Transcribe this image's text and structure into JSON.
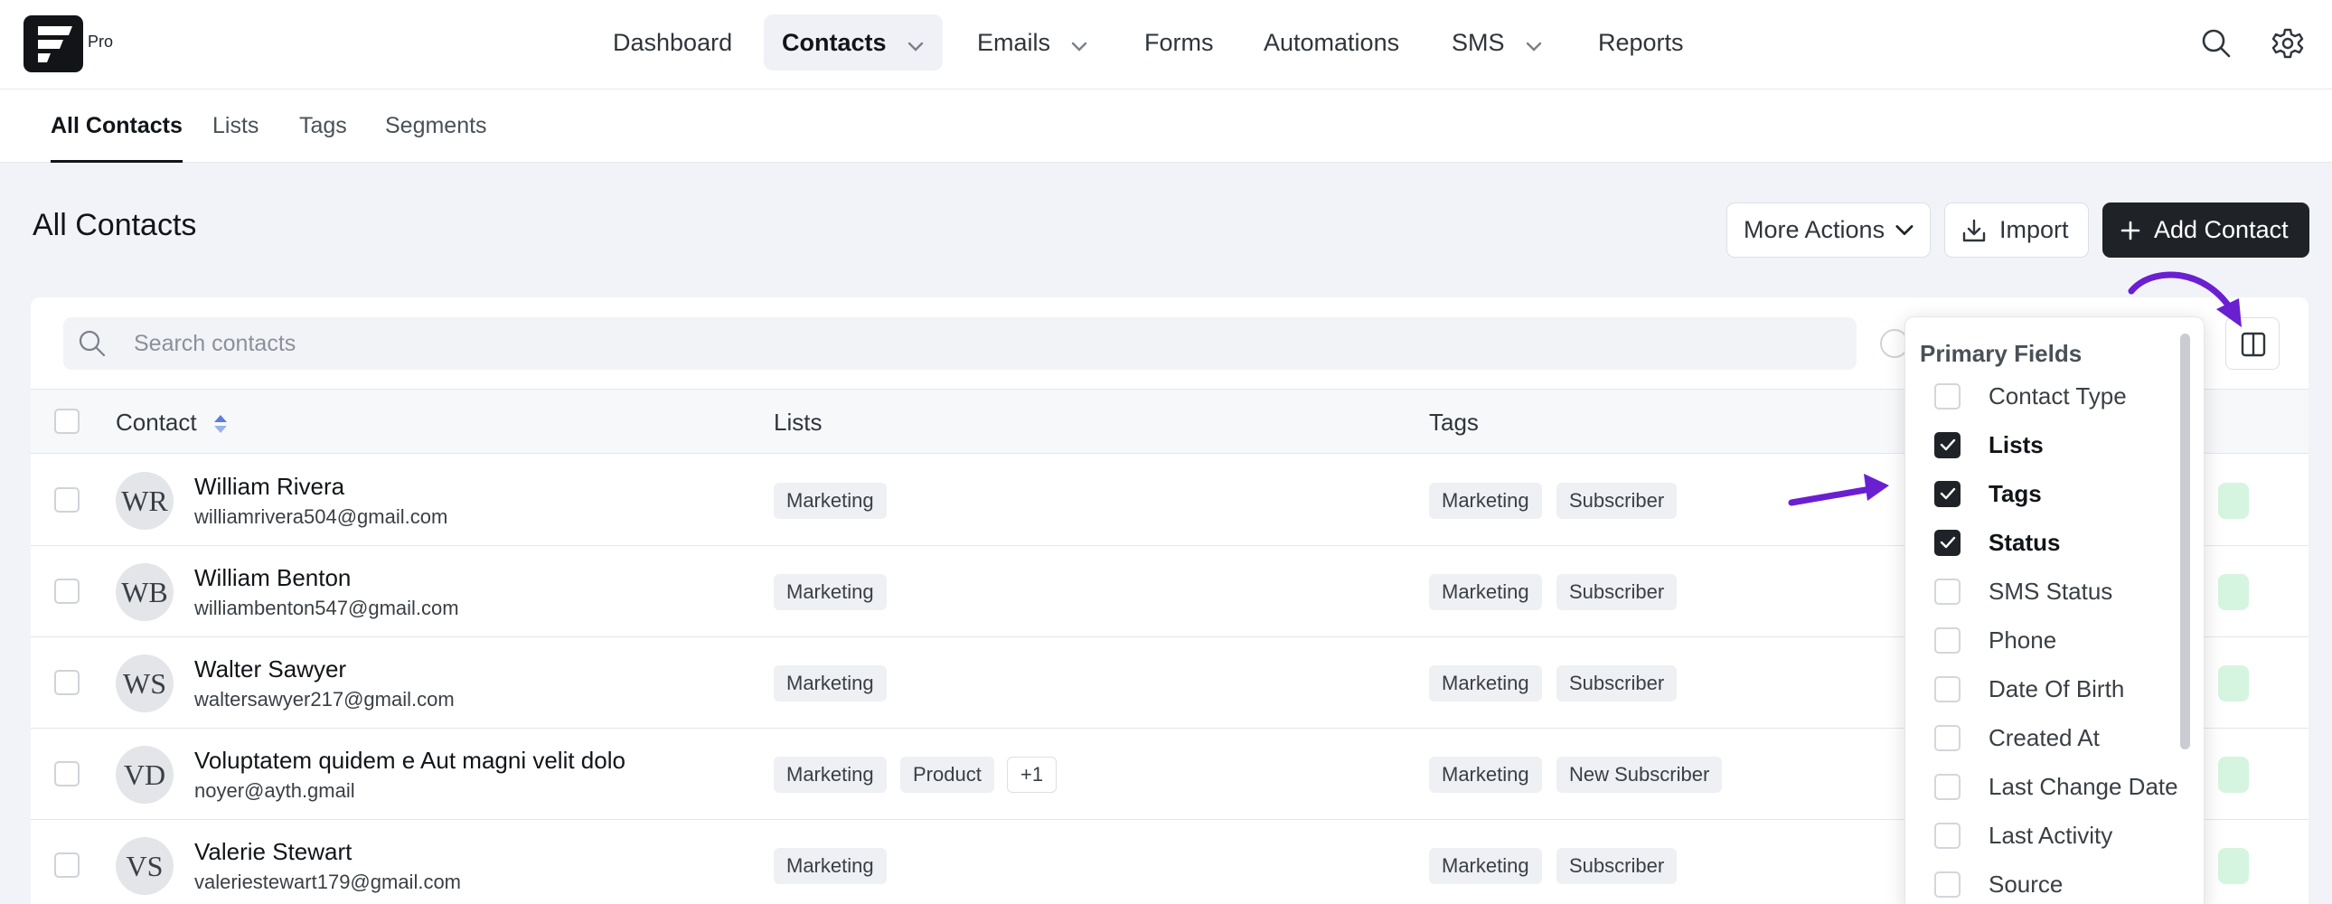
{
  "app": {
    "logo_sub": "Pro"
  },
  "nav": {
    "items": [
      {
        "label": "Dashboard"
      },
      {
        "label": "Contacts"
      },
      {
        "label": "Emails"
      },
      {
        "label": "Forms"
      },
      {
        "label": "Automations"
      },
      {
        "label": "SMS"
      },
      {
        "label": "Reports"
      }
    ],
    "active": "Contacts"
  },
  "subnav": {
    "tabs": [
      {
        "label": "All Contacts"
      },
      {
        "label": "Lists"
      },
      {
        "label": "Tags"
      },
      {
        "label": "Segments"
      }
    ],
    "active": "All Contacts"
  },
  "page": {
    "title": "All Contacts",
    "more_actions_label": "More Actions",
    "import_label": "Import",
    "add_contact_label": "Add Contact"
  },
  "search": {
    "placeholder": "Search contacts",
    "value": ""
  },
  "table": {
    "headers": {
      "contact": "Contact",
      "lists": "Lists",
      "tags": "Tags"
    },
    "rows": [
      {
        "initials": "WR",
        "name": "William Rivera",
        "email": "williamrivera504@gmail.com",
        "lists": [
          "Marketing"
        ],
        "tags": [
          "Marketing",
          "Subscriber"
        ]
      },
      {
        "initials": "WB",
        "name": "William Benton",
        "email": "williambenton547@gmail.com",
        "lists": [
          "Marketing"
        ],
        "tags": [
          "Marketing",
          "Subscriber"
        ]
      },
      {
        "initials": "WS",
        "name": "Walter Sawyer",
        "email": "waltersawyer217@gmail.com",
        "lists": [
          "Marketing"
        ],
        "tags": [
          "Marketing",
          "Subscriber"
        ]
      },
      {
        "initials": "VD",
        "name": "Voluptatem quidem e Aut magni velit dolo",
        "email": "noyer@ayth.gmail",
        "lists": [
          "Marketing",
          "Product",
          "+1"
        ],
        "tags": [
          "Marketing",
          "New Subscriber"
        ]
      },
      {
        "initials": "VS",
        "name": "Valerie Stewart",
        "email": "valeriestewart179@gmail.com",
        "lists": [
          "Marketing"
        ],
        "tags": [
          "Marketing",
          "Subscriber"
        ]
      }
    ]
  },
  "column_menu": {
    "title": "Primary Fields",
    "fields": [
      {
        "label": "Contact Type",
        "checked": false
      },
      {
        "label": "Lists",
        "checked": true
      },
      {
        "label": "Tags",
        "checked": true
      },
      {
        "label": "Status",
        "checked": true
      },
      {
        "label": "SMS Status",
        "checked": false
      },
      {
        "label": "Phone",
        "checked": false
      },
      {
        "label": "Date Of Birth",
        "checked": false
      },
      {
        "label": "Created At",
        "checked": false
      },
      {
        "label": "Last Change Date",
        "checked": false
      },
      {
        "label": "Last Activity",
        "checked": false
      },
      {
        "label": "Source",
        "checked": false
      }
    ]
  },
  "colors": {
    "accent_dark": "#1f2328",
    "annotation_arrow": "#6a1fd1",
    "status_green": "#d6f5e0",
    "sort_icon": "#3b82f6"
  },
  "icons": [
    "search-icon",
    "settings-gear-icon",
    "chevron-down-icon",
    "download-icon",
    "plus-icon",
    "columns-icon",
    "sort-icon",
    "check-icon"
  ]
}
